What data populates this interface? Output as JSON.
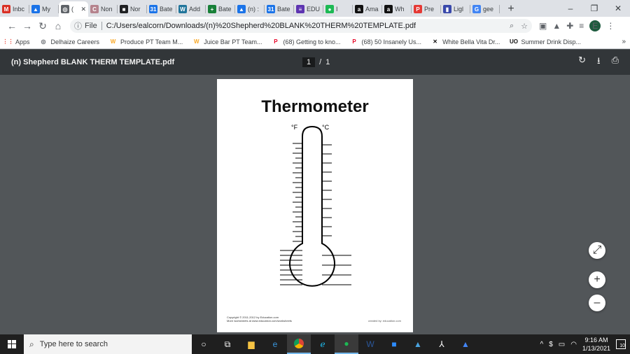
{
  "tabs": [
    {
      "label": "Inbc",
      "icon": "gmail-icon",
      "color": "#d93025",
      "glyph": "M"
    },
    {
      "label": "My",
      "icon": "drive-icon",
      "color": "#1a73e8",
      "glyph": "▲"
    },
    {
      "label": "(",
      "icon": "globe-icon",
      "color": "#5f6368",
      "glyph": "◎",
      "active": true
    },
    {
      "label": "Non",
      "icon": "c-icon",
      "color": "#b5838d",
      "glyph": "C"
    },
    {
      "label": "Nor",
      "icon": "square-icon",
      "color": "#202124",
      "glyph": "■"
    },
    {
      "label": "Bate",
      "icon": "calendar-icon",
      "color": "#1a73e8",
      "glyph": "31"
    },
    {
      "label": "Add",
      "icon": "wordpress-icon",
      "color": "#21759b",
      "glyph": "W"
    },
    {
      "label": "Bate",
      "icon": "sheets-icon",
      "color": "#188038",
      "glyph": "+"
    },
    {
      "label": "(n) :",
      "icon": "drive-icon",
      "color": "#1a73e8",
      "glyph": "▲"
    },
    {
      "label": "Bate",
      "icon": "calendar-icon",
      "color": "#1a73e8",
      "glyph": "31"
    },
    {
      "label": "EDU",
      "icon": "edu-icon",
      "color": "#5e35b1",
      "glyph": "≡"
    },
    {
      "label": "I",
      "icon": "spotify-icon",
      "color": "#1db954",
      "glyph": "●"
    },
    {
      "label": "Ama",
      "icon": "amazon-icon",
      "color": "#111111",
      "glyph": "a"
    },
    {
      "label": "Wh",
      "icon": "amazon-icon",
      "color": "#111111",
      "glyph": "a"
    },
    {
      "label": "Pre",
      "icon": "pre-icon",
      "color": "#e53935",
      "glyph": "P"
    },
    {
      "label": "Ligl",
      "icon": "bookmark-icon",
      "color": "#3949ab",
      "glyph": "▮"
    },
    {
      "label": "gee",
      "icon": "google-icon",
      "color": "#4285f4",
      "glyph": "G"
    }
  ],
  "window_controls": {
    "minimize": "–",
    "restore": "❐",
    "close": "✕"
  },
  "toolbar": {
    "file_label": "File",
    "url": "C:/Users/ealcorn/Downloads/(n)%20Shepherd%20BLANK%20THERM%20TEMPLATE.pdf",
    "profile_initial": "E"
  },
  "bookmarks": [
    {
      "label": "Apps",
      "icon": "apps-icon",
      "color": "#ea4335",
      "glyph": "⋮⋮"
    },
    {
      "label": "Delhaize Careers",
      "icon": "globe-icon",
      "color": "#5f6368",
      "glyph": "◎"
    },
    {
      "label": "Produce PT Team M...",
      "icon": "walmart-icon",
      "color": "#f9a825",
      "glyph": "W"
    },
    {
      "label": "Juice Bar PT Team...",
      "icon": "walmart-icon",
      "color": "#f9a825",
      "glyph": "W"
    },
    {
      "label": "(68) Getting to kno...",
      "icon": "pinterest-icon",
      "color": "#e60023",
      "glyph": "P"
    },
    {
      "label": "(68) 50 Insanely Us...",
      "icon": "pinterest-icon",
      "color": "#e60023",
      "glyph": "P"
    },
    {
      "label": "White Bella Vita Dr...",
      "icon": "x-icon",
      "color": "#111111",
      "glyph": "✕"
    },
    {
      "label": "Summer Drink Disp...",
      "icon": "uo-icon",
      "color": "#111111",
      "glyph": "UO"
    }
  ],
  "bookmarks_more": "»",
  "pdf": {
    "title": "(n) Shepherd BLANK THERM TEMPLATE.pdf",
    "current_page": "1",
    "page_separator": "/",
    "total_pages": "1",
    "page_heading": "Thermometer",
    "unit_f": "°F",
    "unit_c": "°C",
    "copyright_line1": "Copyright © 2011-2012 by Education.com",
    "copyright_line2": "More worksheets at www.education.com/worksheets",
    "created_by": "created by: education.com"
  },
  "zoom": {
    "fit": "⤢",
    "in": "+",
    "out": "–"
  },
  "taskbar": {
    "search_placeholder": "Type here to search",
    "time": "9:16 AM",
    "date": "1/13/2021",
    "notifications": "10"
  }
}
